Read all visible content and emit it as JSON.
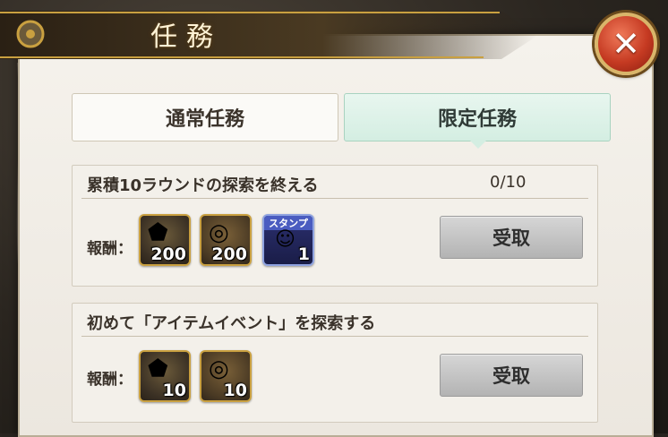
{
  "header": {
    "title": "任務",
    "close_label": "✕"
  },
  "tabs": [
    {
      "label": "通常任務",
      "selected": false
    },
    {
      "label": "限定任務",
      "selected": true
    }
  ],
  "missions": [
    {
      "title": "累積10ラウンドの探索を終える",
      "progress": "0/10",
      "reward_label": "報酬：",
      "rewards": [
        {
          "icon": "ore-icon",
          "qty": "200"
        },
        {
          "icon": "coin-icon",
          "qty": "200"
        },
        {
          "icon": "stamp-icon",
          "label": "スタンプ",
          "qty": "1"
        }
      ],
      "claim_label": "受取"
    },
    {
      "title": "初めて「アイテムイベント」を探索する",
      "reward_label": "報酬：",
      "rewards": [
        {
          "icon": "ore-icon",
          "qty": "10"
        },
        {
          "icon": "coin-icon",
          "qty": "10"
        }
      ],
      "claim_label": "受取"
    }
  ],
  "colors": {
    "accent_tab": "#d4eee2",
    "close_button": "#c53a22",
    "gold_trim": "#c9a040"
  }
}
